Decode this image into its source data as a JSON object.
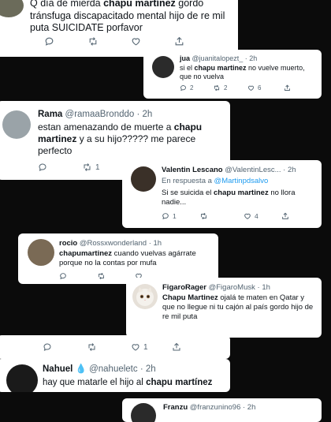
{
  "t1": {
    "text_a": "Q día de mierda ",
    "mention": "chapu martínez",
    "text_b": " gordo tránsfuga discapacitado mental hijo de re mil puta SUICIDATE porfavor",
    "icons": [
      "reply-icon",
      "retweet-icon",
      "like-icon",
      "share-icon"
    ]
  },
  "t2": {
    "name": "jua",
    "handle": "@juanitalopezt_",
    "time": "· 2h",
    "text_a": "si el ",
    "mention": "chapu martinez",
    "text_b": " no vuelve muerto, que no vuelva",
    "reply_count": "2",
    "retweet_count": "2",
    "like_count": "6"
  },
  "t3": {
    "name": "Rama",
    "handle": "@ramaaBronddo",
    "time": "· 2h",
    "text_a": "estan amenazando de muerte a ",
    "mention": "chapu martinez",
    "text_b": " y a su hijo????? me parece perfecto",
    "retweet_count": "1"
  },
  "t4": {
    "name": "Valentin Lescano",
    "handle": "@ValentinLesc...",
    "time": "· 2h",
    "reply_prefix": "En respuesta a ",
    "reply_to": "@Martinpdsalvo",
    "text_a": "Si se suicida el ",
    "mention": "chapu martinez",
    "text_b": " no llora nadie...",
    "reply_count": "1",
    "like_count": "4"
  },
  "t5": {
    "name": "rocio",
    "handle": "@Rossxwonderland",
    "time": "· 1h",
    "mention": "chapumartinez",
    "text_b": " cuando vuelvas agárrate porque no la contas por mufa"
  },
  "t6": {
    "name": "FigaroRager",
    "handle": "@FigaroMusk",
    "time": "· 1h",
    "mention": "Chapu Martinez",
    "text_b": " ojalá te maten en Qatar y que no llegue ni tu cajón al país gordo hijo de re mil puta"
  },
  "t7": {
    "like_count": "1"
  },
  "t8": {
    "name": "Nahuel",
    "emoji": "💧",
    "handle": "@nahueletc",
    "time": "· 2h",
    "text_a": "hay que matarle el hijo al ",
    "mention": "chapu martínez"
  },
  "t9": {
    "name": "Franzu",
    "handle": "@franzunino96",
    "time": "· 2h"
  },
  "colors": {
    "background": "#0b0b0b",
    "card": "#ffffff",
    "text": "#0f1419",
    "muted": "#536471",
    "link": "#1d9bf0"
  }
}
